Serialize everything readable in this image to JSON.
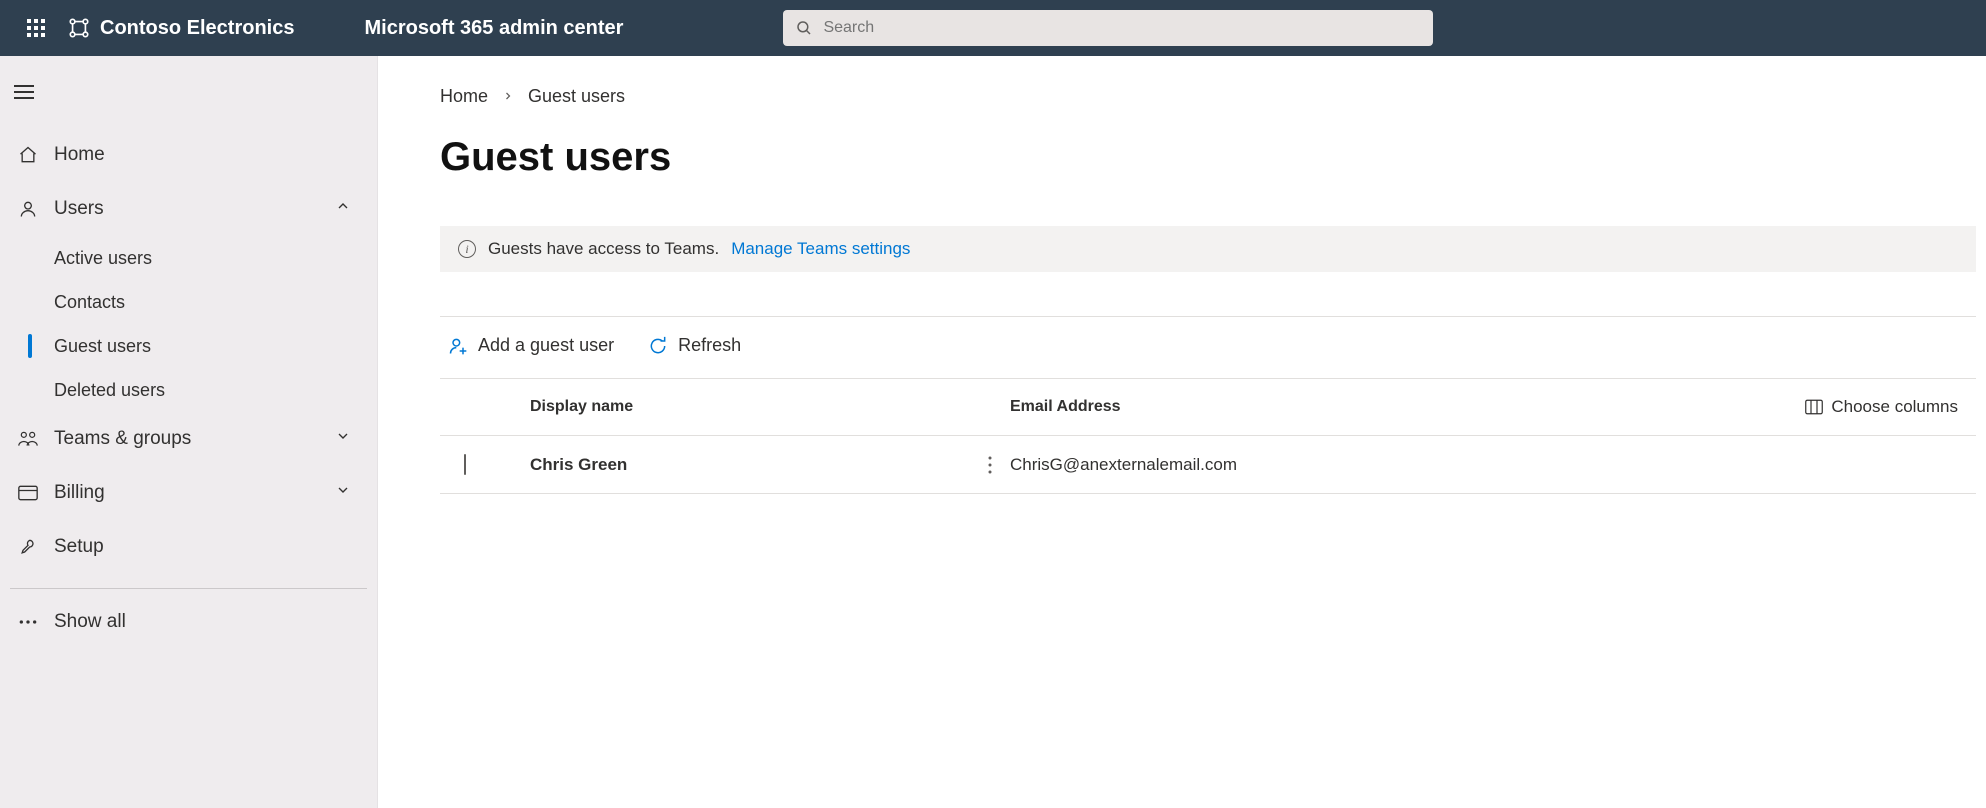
{
  "header": {
    "org_name": "Contoso Electronics",
    "app_title": "Microsoft 365 admin center",
    "search_placeholder": "Search"
  },
  "sidebar": {
    "items": [
      {
        "label": "Home"
      },
      {
        "label": "Users",
        "expanded": true
      },
      {
        "label": "Teams & groups"
      },
      {
        "label": "Billing"
      },
      {
        "label": "Setup"
      },
      {
        "label": "Show all"
      }
    ],
    "users_subitems": [
      {
        "label": "Active users"
      },
      {
        "label": "Contacts"
      },
      {
        "label": "Guest users"
      },
      {
        "label": "Deleted users"
      }
    ]
  },
  "breadcrumb": {
    "root": "Home",
    "current": "Guest users"
  },
  "page": {
    "title": "Guest users",
    "info_text": "Guests have access to Teams.",
    "info_link": "Manage Teams settings"
  },
  "commands": {
    "add": "Add a guest user",
    "refresh": "Refresh"
  },
  "table": {
    "col_display": "Display name",
    "col_email": "Email Address",
    "choose_columns": "Choose columns",
    "rows": [
      {
        "name": "Chris  Green",
        "email": "ChrisG@anexternalemail.com"
      }
    ]
  }
}
